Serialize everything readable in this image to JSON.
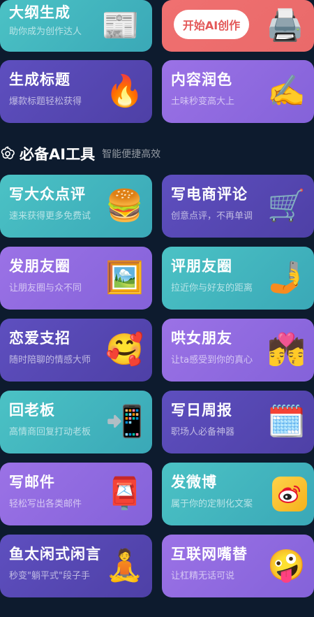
{
  "top_row": [
    {
      "title": "大纲生成",
      "subtitle": "助你成为创作达人",
      "icon": "newspaper-icon",
      "emoji": "📰"
    },
    {
      "button_label": "开始AI创作",
      "icon": "printer-icon",
      "emoji": "🖨️"
    }
  ],
  "row2": [
    {
      "title": "生成标题",
      "subtitle": "爆款标题轻松获得",
      "icon": "fire-icon",
      "emoji": "🔥"
    },
    {
      "title": "内容润色",
      "subtitle": "土味秒变高大上",
      "icon": "writing-hand-icon",
      "emoji": "✍️"
    }
  ],
  "section": {
    "title": "必备AI工具",
    "subtitle": "智能便捷高效",
    "icon": "openai-logo-icon"
  },
  "tools": [
    {
      "title": "写大众点评",
      "subtitle": "速来获得更多免费试",
      "icon": "burger-icon",
      "emoji": "🍔",
      "color": "teal"
    },
    {
      "title": "写电商评论",
      "subtitle": "创意点评，不再单调",
      "icon": "shopping-cart-icon",
      "emoji": "🛒",
      "color": "indigo"
    },
    {
      "title": "发朋友圈",
      "subtitle": "让朋友圈与众不同",
      "icon": "framed-picture-icon",
      "emoji": "🖼️",
      "color": "purple"
    },
    {
      "title": "评朋友圈",
      "subtitle": "拉近你与好友的距离",
      "icon": "selfie-icon",
      "emoji": "🤳",
      "color": "teal"
    },
    {
      "title": "恋爱支招",
      "subtitle": "随时陪聊的情感大师",
      "icon": "smiling-face-with-hearts-icon",
      "emoji": "🥰",
      "color": "indigo"
    },
    {
      "title": "哄女朋友",
      "subtitle": "让ta感受到你的真心",
      "icon": "kiss-icon",
      "emoji": "💏",
      "color": "purple"
    },
    {
      "title": "回老板",
      "subtitle": "高情商回复打动老板",
      "icon": "mobile-arrow-icon",
      "emoji": "📲",
      "color": "teal"
    },
    {
      "title": "写日周报",
      "subtitle": "职场人必备神器",
      "icon": "calendar-icon",
      "emoji": "🗓️",
      "color": "indigo"
    },
    {
      "title": "写邮件",
      "subtitle": "轻松写出各类邮件",
      "icon": "postbox-icon",
      "emoji": "📮",
      "color": "purple"
    },
    {
      "title": "发微博",
      "subtitle": "属于你的定制化文案",
      "icon": "weibo-icon",
      "emoji": "",
      "color": "teal"
    },
    {
      "title": "鱼太闲式闲言",
      "subtitle": "秒变\"躺平式\"段子手",
      "icon": "lying-figure-icon",
      "emoji": "🧘",
      "color": "indigo"
    },
    {
      "title": "互联网嘴替",
      "subtitle": "让杠精无话可说",
      "icon": "zany-face-icon",
      "emoji": "🤪",
      "color": "purple"
    }
  ]
}
